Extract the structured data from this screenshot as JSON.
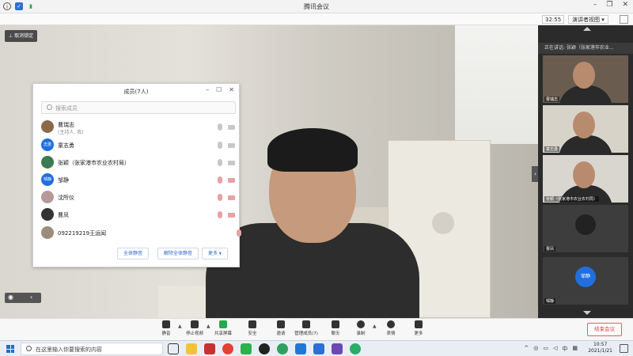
{
  "window": {
    "title": "腾讯会议",
    "timer": "32:55",
    "view_mode": "演讲者视图 ▾"
  },
  "main_video": {
    "unpin_label": "取消锁定"
  },
  "members_panel": {
    "title": "成员(7人)",
    "search_placeholder": "搜索成员",
    "members": [
      {
        "name": "曹瑞志",
        "sub": "(主持人, 我)",
        "avatar_text": "",
        "avatar_color": "#8a6a4b",
        "mic_off": false,
        "cam_off": false
      },
      {
        "name": "童志勇",
        "sub": "",
        "avatar_text": "志勇",
        "avatar_color": "#1f6fe0",
        "mic_off": false,
        "cam_off": false
      },
      {
        "name": "张颖（张家港市农业农村局）",
        "sub": "",
        "avatar_text": "",
        "avatar_color": "#3c7a4f",
        "mic_off": false,
        "cam_off": false
      },
      {
        "name": "邹静",
        "sub": "",
        "avatar_text": "邹静",
        "avatar_color": "#1f6fe0",
        "mic_off": true,
        "cam_off": true
      },
      {
        "name": "沈所仪",
        "sub": "",
        "avatar_text": "",
        "avatar_color": "#b59a9a",
        "mic_off": true,
        "cam_off": true
      },
      {
        "name": "曹凤",
        "sub": "",
        "avatar_text": "",
        "avatar_color": "#333333",
        "mic_off": true,
        "cam_off": true
      },
      {
        "name": "092219219王运闻",
        "sub": "",
        "avatar_text": "",
        "avatar_color": "#9a8d7a",
        "mic_off": true,
        "cam_off": false
      }
    ],
    "buttons": {
      "mute_all": "全体静音",
      "unmute_all": "解除全体静音",
      "more": "更多 ▾"
    }
  },
  "gallery": {
    "speaking": "正在讲话: 张颖（张家港市农业...",
    "tiles": [
      {
        "label": "曹瑞志",
        "type": "video"
      },
      {
        "label": "童志勇",
        "type": "video"
      },
      {
        "label": "张颖（张家港市农业农村局）",
        "type": "video"
      },
      {
        "label": "曹凤",
        "type": "avatar",
        "avatar_text": ""
      },
      {
        "label": "邹静",
        "type": "avatar",
        "avatar_text": "邹静"
      }
    ]
  },
  "controls": {
    "items": [
      "静音",
      "停止视频",
      "共享屏幕",
      "安全",
      "邀请",
      "管理成员(7)",
      "聊天",
      "录制",
      "表情",
      "更多"
    ],
    "end_label": "结束会议"
  },
  "taskbar": {
    "search_text": "在这里输入你要搜索的内容",
    "ime": "中",
    "time": "10:57",
    "date": "2021/1/21"
  }
}
